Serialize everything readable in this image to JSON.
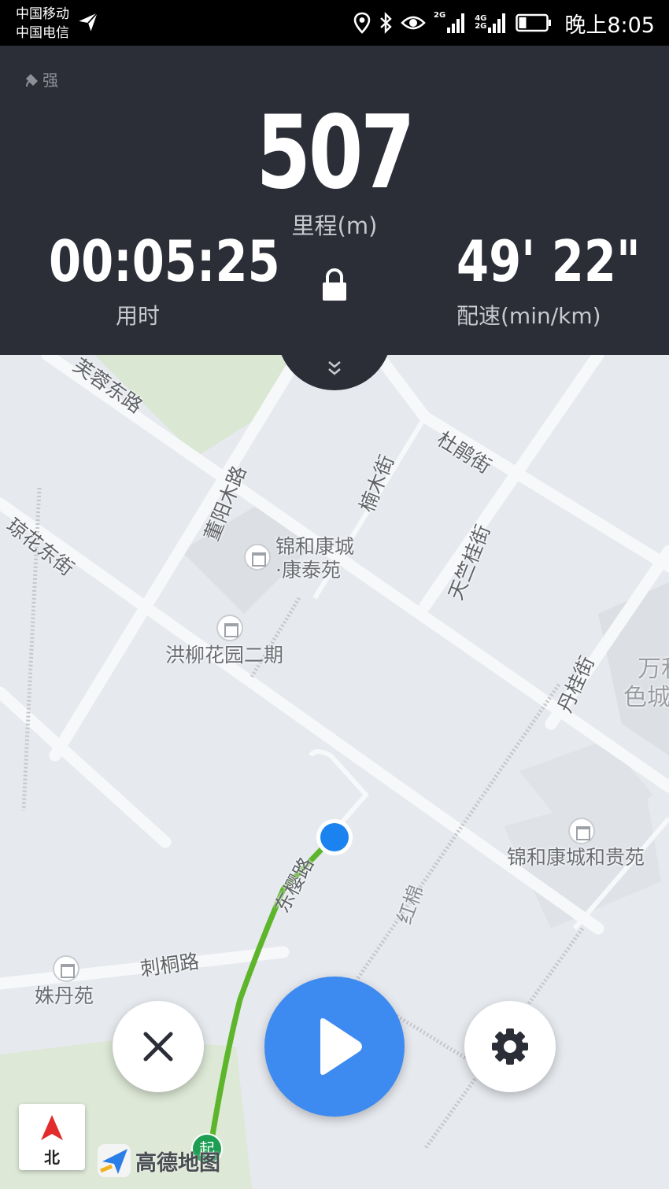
{
  "status_bar": {
    "carrier_1": "中国移动",
    "carrier_2": "中国电信",
    "net_1": "2G",
    "net_2_top": "4G",
    "net_2_bottom": "2G",
    "time": "晚上8:05",
    "icons": [
      "send-icon",
      "location-icon",
      "bluetooth-icon",
      "eye-icon",
      "signal-icon",
      "battery-icon"
    ]
  },
  "stats": {
    "gps_label": "强",
    "distance": "507",
    "distance_label": "里程(m)",
    "duration": "00:05:25",
    "duration_label": "用时",
    "pace": "49' 22\"",
    "pace_label": "配速(min/km)"
  },
  "map": {
    "roads": [
      "芙蓉东路",
      "董阳木路",
      "琼花东街",
      "楠木街",
      "杜鹃街",
      "天竺桂街",
      "丹桂街",
      "刺桐路",
      "东樱路",
      "红棉"
    ],
    "pois": {
      "poi_1_line1": "锦和康城",
      "poi_1_line2": "·康泰苑",
      "poi_2": "洪柳花园二期",
      "poi_3": "锦和康城和贵苑",
      "poi_4": "姝丹苑",
      "poi_5_line1": "万和",
      "poi_5_line2": "色城"
    },
    "start_marker": "起",
    "compass_label": "北",
    "brand": "高德地图"
  },
  "colors": {
    "header_bg": "#2b2d37",
    "accent_blue": "#3d8af0",
    "track_green": "#5cb52a",
    "map_bg": "#e6e9ee"
  }
}
